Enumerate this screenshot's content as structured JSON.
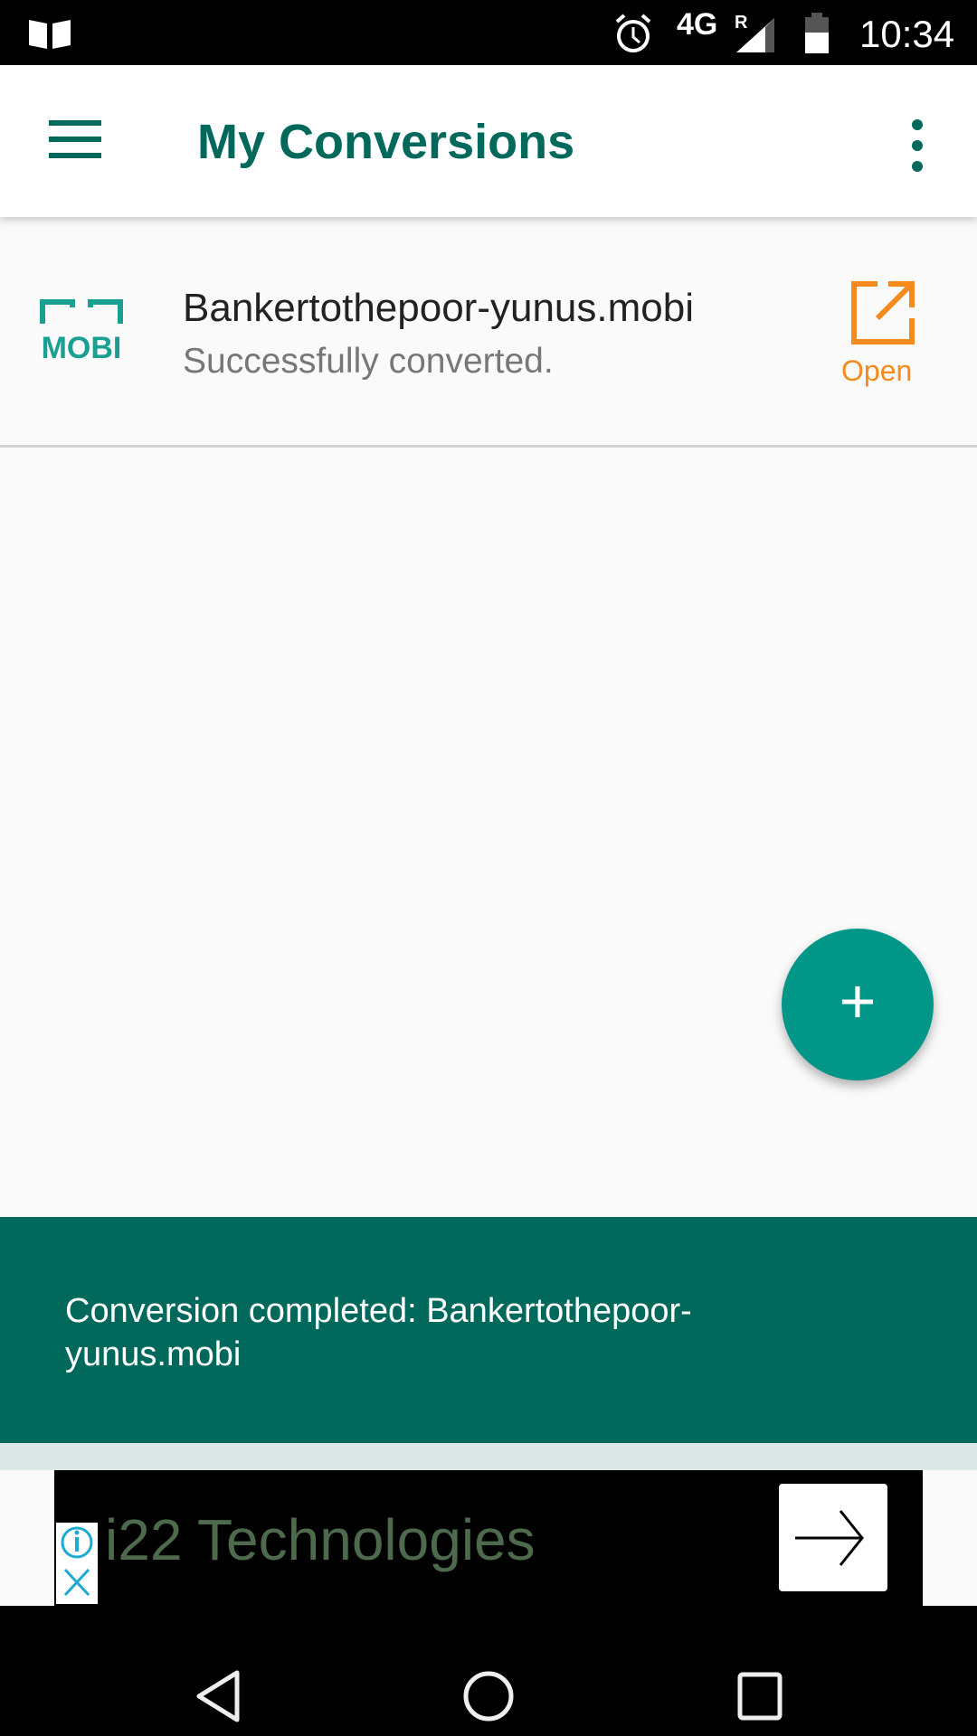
{
  "status_bar": {
    "time": "10:34",
    "network": "4G",
    "roaming": "R",
    "icons": [
      "book-icon",
      "alarm-icon",
      "signal-icon",
      "battery-icon"
    ]
  },
  "app_bar": {
    "title": "My Conversions",
    "menu_icon": "hamburger-icon",
    "overflow_icon": "more-vert-icon"
  },
  "conversions": [
    {
      "file_name": "Bankertothepoor-yunus.mobi",
      "status": "Successfully converted.",
      "format_icon": "mobi",
      "action_label": "Open",
      "action_icon": "open-external-icon"
    }
  ],
  "fab": {
    "icon": "plus-icon",
    "label": "+"
  },
  "snackbar": {
    "message": "Conversion completed: Bankertothepoor-yunus.mobi"
  },
  "ad": {
    "text": "i22 Technologies",
    "icons": [
      "info-icon",
      "close-icon",
      "arrow-right-icon"
    ]
  },
  "colors": {
    "primary": "#00695c",
    "accent": "#009688",
    "action": "#f58a1f"
  }
}
